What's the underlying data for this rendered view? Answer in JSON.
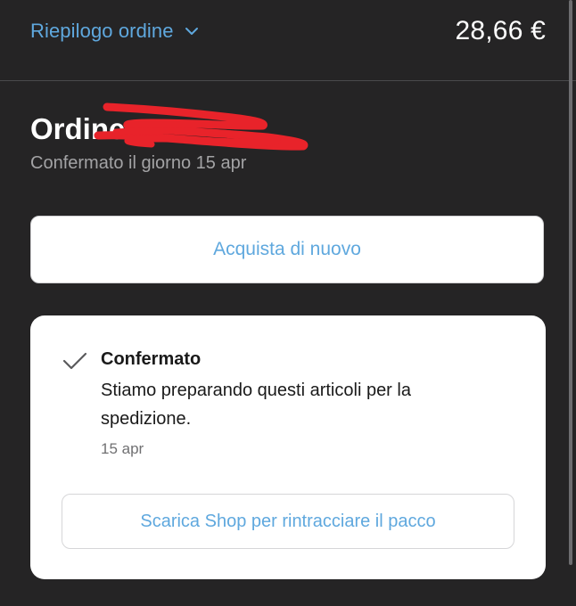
{
  "header": {
    "summary_label": "Riepilogo ordine",
    "total": "28,66 €"
  },
  "order": {
    "title": "Ordine",
    "confirmed_text": "Confermato il giorno 15 apr"
  },
  "actions": {
    "buy_again": "Acquista di nuovo"
  },
  "status_card": {
    "title": "Confermato",
    "description": "Stiamo preparando questi articoli per la spedizione.",
    "date": "15 apr",
    "track_button": "Scarica Shop per rintracciare il pacco"
  },
  "colors": {
    "background": "#252425",
    "accent": "#5fa8de",
    "redaction": "#e8232a"
  },
  "icons": {
    "summary_toggle": "chevron-down-icon",
    "status": "checkmark-icon"
  }
}
